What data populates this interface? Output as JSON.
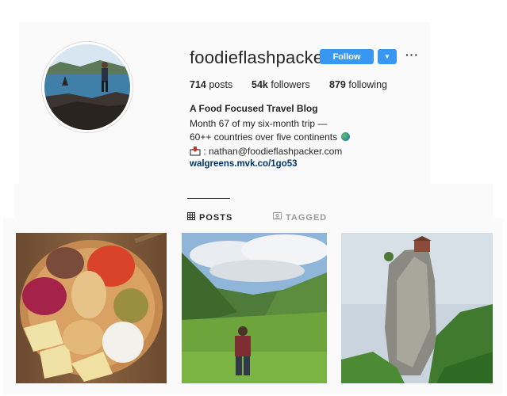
{
  "profile": {
    "username": "foodieflashpacker",
    "follow_label": "Follow",
    "dropdown_icon": "caret-down-icon",
    "more_icon": "ellipsis-icon"
  },
  "stats": {
    "posts_count": "714",
    "posts_label": "posts",
    "followers_count": "54k",
    "followers_label": "followers",
    "following_count": "879",
    "following_label": "following"
  },
  "bio": {
    "name": "A Food Focused Travel Blog",
    "line1": "Month 67 of my six-month trip —",
    "line2": "60++ countries over five continents",
    "email": ": nathan@foodieflashpacker.com",
    "link": "walgreens.mvk.co/1go53"
  },
  "tabs": [
    {
      "label": "POSTS",
      "icon": "grid-icon",
      "active": true
    },
    {
      "label": "TAGGED",
      "icon": "tagged-icon",
      "active": false
    }
  ],
  "posts": [
    {
      "subject": "food platter",
      "icon": "photo"
    },
    {
      "subject": "mountain valley",
      "icon": "photo"
    },
    {
      "subject": "rock pillar",
      "icon": "photo"
    }
  ],
  "colors": {
    "accent": "#3897f0",
    "link": "#003569",
    "muted": "#999999",
    "text": "#262626"
  }
}
